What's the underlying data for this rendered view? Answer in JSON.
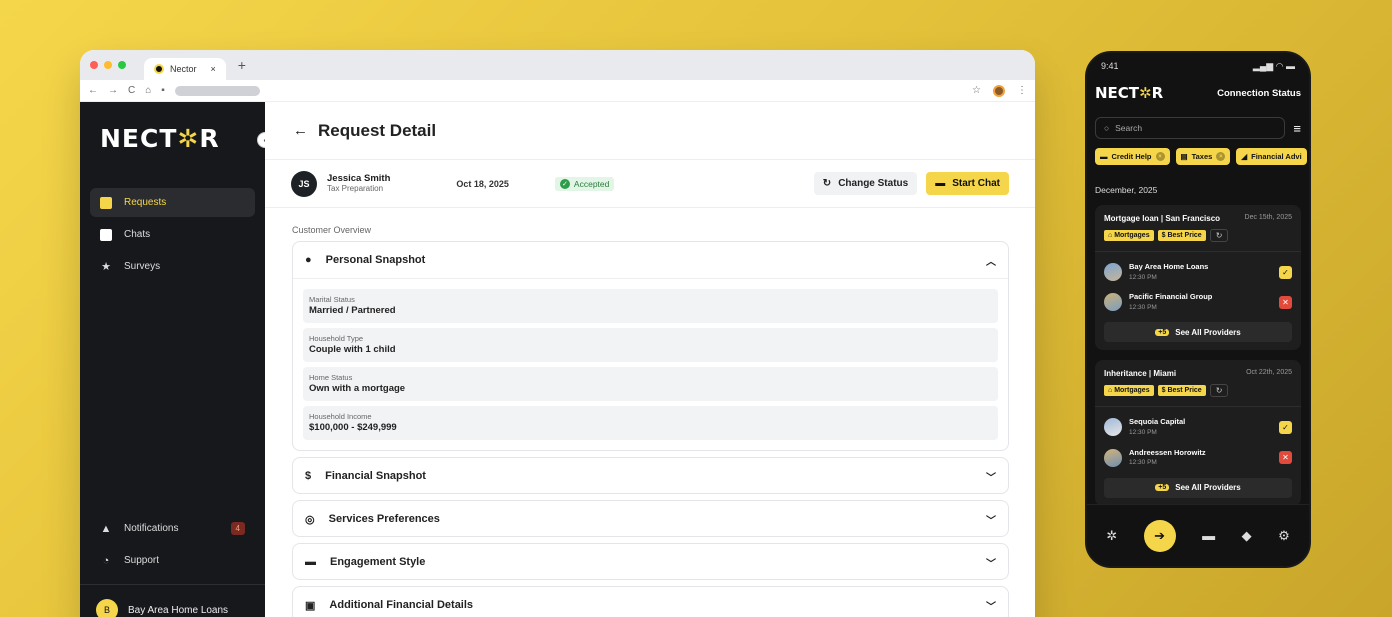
{
  "browser": {
    "tab_title": "Nector",
    "tab_close": "×",
    "new_tab": "+",
    "nav_back": "←",
    "nav_forward": "→",
    "nav_reload": "C",
    "nav_home": "⌂",
    "star": "☆",
    "menu": "⋮"
  },
  "sidebar": {
    "logo_left": "NECT",
    "logo_o": "✲",
    "logo_right": "R",
    "items": [
      {
        "label": "Requests"
      },
      {
        "label": "Chats"
      },
      {
        "label": "Surveys"
      }
    ],
    "bottom": [
      {
        "label": "Notifications",
        "badge": "4"
      },
      {
        "label": "Support"
      }
    ],
    "account": {
      "initial": "B",
      "name": "Bay Area Home Loans"
    }
  },
  "main": {
    "title": "Request Detail",
    "request": {
      "initials": "JS",
      "name": "Jessica Smith",
      "service": "Tax Preparation",
      "date": "Oct 18, 2025",
      "status": "Accepted",
      "change_status": "Change Status",
      "start_chat": "Start Chat"
    },
    "section_label": "Customer Overview",
    "personal": {
      "title": "Personal Snapshot",
      "fields": [
        {
          "label": "Marital Status",
          "value": "Married / Partnered"
        },
        {
          "label": "Household Type",
          "value": "Couple with 1 child"
        },
        {
          "label": "Home Status",
          "value": "Own with a mortgage"
        },
        {
          "label": "Household Income",
          "value": "$100,000 - $249,999"
        }
      ]
    },
    "collapsed": [
      {
        "title": "Financial Snapshot",
        "icon": "$"
      },
      {
        "title": "Services Preferences",
        "icon": "◎"
      },
      {
        "title": "Engagement Style",
        "icon": "▬"
      },
      {
        "title": "Additional Financial Details",
        "icon": "▣"
      }
    ]
  },
  "phone": {
    "time": "9:41",
    "signal": "▂▄▆ ◠ ▬",
    "logo_left": "NECT",
    "logo_o": "✲",
    "logo_right": "R",
    "connection": "Connection Status",
    "search_placeholder": "Search",
    "chips": [
      "Credit Help",
      "Taxes",
      "Financial Advi"
    ],
    "month": "December, 2025",
    "cards": [
      {
        "title": "Mortgage loan | San Francisco",
        "date": "Dec 15th, 2025",
        "tags": [
          "Mortgages",
          "Best Price"
        ],
        "providers": [
          {
            "name": "Bay Area Home Loans",
            "time": "12:30 PM",
            "state": "ok"
          },
          {
            "name": "Pacific Financial Group",
            "time": "12:30 PM",
            "state": "no"
          }
        ],
        "more": "+5",
        "see_all": "See All Providers"
      },
      {
        "title": "Inheritance | Miami",
        "date": "Oct 22th, 2025",
        "tags": [
          "Mortgages",
          "Best Price"
        ],
        "providers": [
          {
            "name": "Sequoia Capital",
            "time": "12:30 PM",
            "state": "ok"
          },
          {
            "name": "Andreessen Horowitz",
            "time": "12:30 PM",
            "state": "no"
          }
        ],
        "more": "+5",
        "see_all": "See All Providers"
      }
    ],
    "accent": "#f5d64a"
  }
}
